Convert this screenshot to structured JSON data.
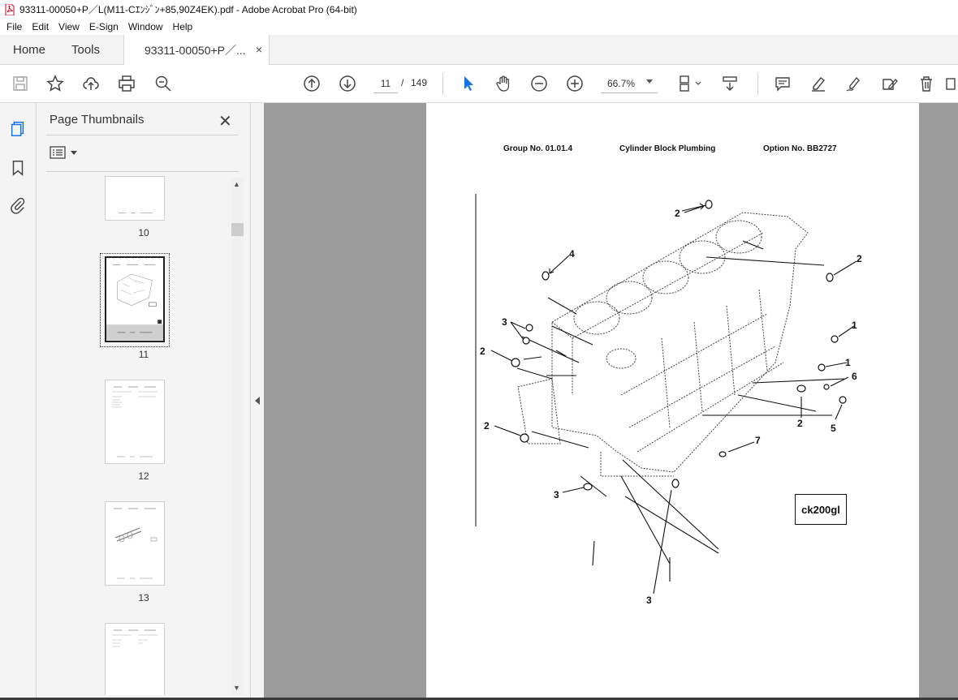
{
  "window": {
    "title": "93311-00050+P／L(M11-Cｴﾝｼﾞﾝ+85,90Z4EK).pdf - Adobe Acrobat Pro (64-bit)"
  },
  "menu": [
    "File",
    "Edit",
    "View",
    "E-Sign",
    "Window",
    "Help"
  ],
  "tabs": {
    "home": "Home",
    "tools": "Tools",
    "document": "93311-00050+P／...",
    "close": "×"
  },
  "toolbar": {
    "current_page": "11",
    "page_separator": "/",
    "total_pages": "149",
    "zoom": "66.7%"
  },
  "panel": {
    "title": "Page Thumbnails",
    "close": "✕",
    "thumbnails": [
      {
        "label": "10"
      },
      {
        "label": "11",
        "selected": true
      },
      {
        "label": "12"
      },
      {
        "label": "13"
      },
      {
        "label": ""
      }
    ]
  },
  "document": {
    "group": "Group No. 01.01.4",
    "heading": "Cylinder Block Plumbing",
    "option": "Option No. BB2727",
    "figure_code": "ck200gl",
    "callouts": [
      "2",
      "2",
      "4",
      "3",
      "2",
      "1",
      "1",
      "6",
      "2",
      "5",
      "2",
      "7",
      "3",
      "3"
    ]
  },
  "colors": {
    "accent": "#1473e6",
    "viewport": "#9b9b9b",
    "panel": "#f4f4f4"
  }
}
